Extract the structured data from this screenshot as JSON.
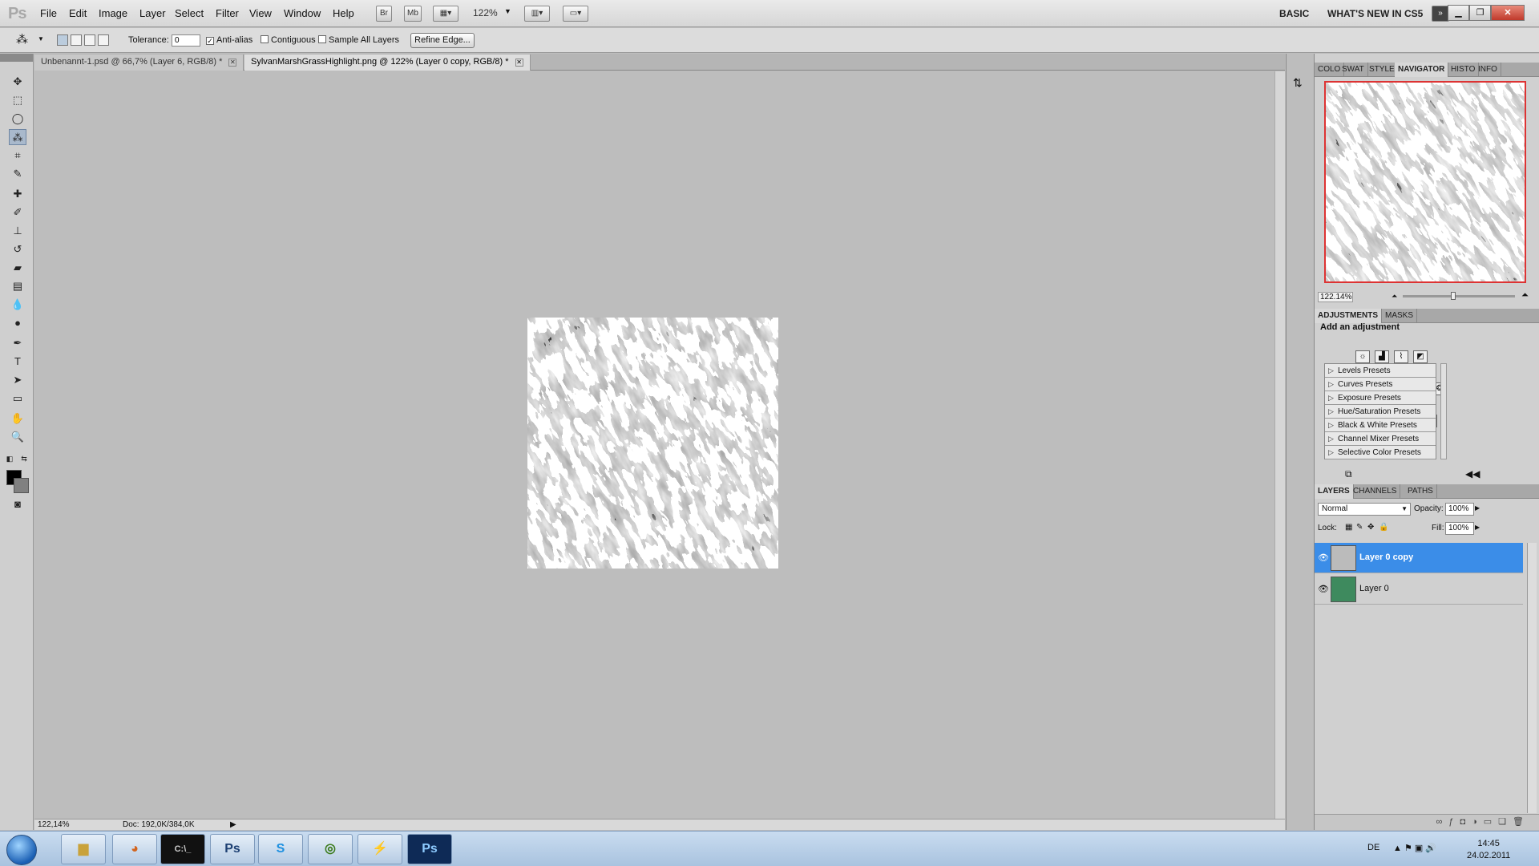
{
  "menubar": {
    "logo": "Ps",
    "menus": [
      "File",
      "Edit",
      "Image",
      "Layer",
      "Select",
      "Filter",
      "View",
      "Window",
      "Help"
    ],
    "bridge": "Br",
    "minibridge": "Mb",
    "zoom": "122%",
    "workspace": "BASIC",
    "whats_new": "WHAT'S NEW IN CS5"
  },
  "options": {
    "tolerance_label": "Tolerance:",
    "tolerance_value": "0",
    "antialias": "Anti-alias",
    "contiguous": "Contiguous",
    "sample_all": "Sample All Layers",
    "refine_edge": "Refine Edge..."
  },
  "tabs": [
    {
      "label": "Unbenannt-1.psd @ 66,7% (Layer 6, RGB/8) *"
    },
    {
      "label": "SylvanMarshGrassHighlight.png @ 122% (Layer 0 copy, RGB/8) *"
    }
  ],
  "status": {
    "zoom": "122,14%",
    "doc": "Doc: 192,0K/384,0K"
  },
  "panels": {
    "top_tabs": [
      "COLO",
      "SWAT",
      "STYLE",
      "NAVIGATOR",
      "HISTO",
      "INFO"
    ],
    "navigator_zoom": "122.14%",
    "adj_tabs": [
      "ADJUSTMENTS",
      "MASKS"
    ],
    "adj_title": "Add an adjustment",
    "presets": [
      "Levels Presets",
      "Curves Presets",
      "Exposure Presets",
      "Hue/Saturation Presets",
      "Black & White Presets",
      "Channel Mixer Presets",
      "Selective Color Presets"
    ],
    "layer_tabs": [
      "LAYERS",
      "CHANNELS",
      "PATHS"
    ],
    "blend_mode": "Normal",
    "opacity_label": "Opacity:",
    "opacity": "100%",
    "lock_label": "Lock:",
    "fill_label": "Fill:",
    "fill": "100%",
    "layers": [
      {
        "name": "Layer 0 copy",
        "selected": true
      },
      {
        "name": "Layer 0",
        "selected": false
      }
    ]
  },
  "taskbar": {
    "lang": "DE",
    "time": "14:45",
    "date": "24.02.2011"
  },
  "colors": {
    "selection": "#3b8de8",
    "navigator_frame": "#dd3333"
  }
}
